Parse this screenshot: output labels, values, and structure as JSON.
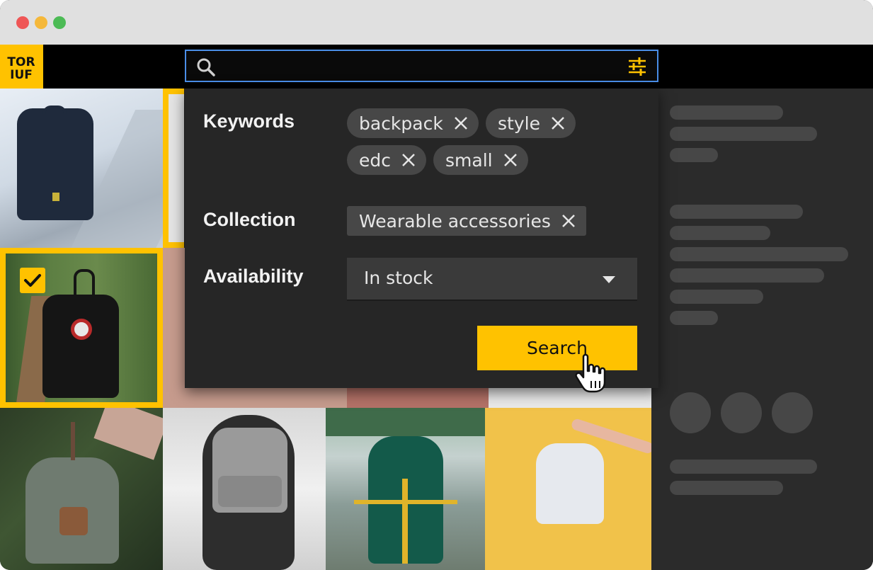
{
  "window": {
    "controls": [
      "close",
      "minimize",
      "zoom"
    ]
  },
  "appbar": {
    "logo_text_top": "TOR",
    "logo_text_bottom": "IUF",
    "search_placeholder": "",
    "search_value": ""
  },
  "filters": {
    "keywords_label": "Keywords",
    "keywords": [
      "backpack",
      "style",
      "edc",
      "small"
    ],
    "collection_label": "Collection",
    "collection": "Wearable accessories",
    "availability_label": "Availability",
    "availability_value": "In stock",
    "search_button": "Search"
  },
  "grid": {
    "selected_tile": 3
  },
  "colors": {
    "accent": "#ffc200",
    "focus_border": "#4a8ee8",
    "panel_bg": "#262626",
    "chip_bg": "#474747",
    "appbar_bg": "#000000"
  },
  "icons": [
    "search-icon",
    "sliders-icon",
    "close-icon",
    "chevron-down-icon",
    "checkmark-icon",
    "hand-pointer-icon"
  ]
}
